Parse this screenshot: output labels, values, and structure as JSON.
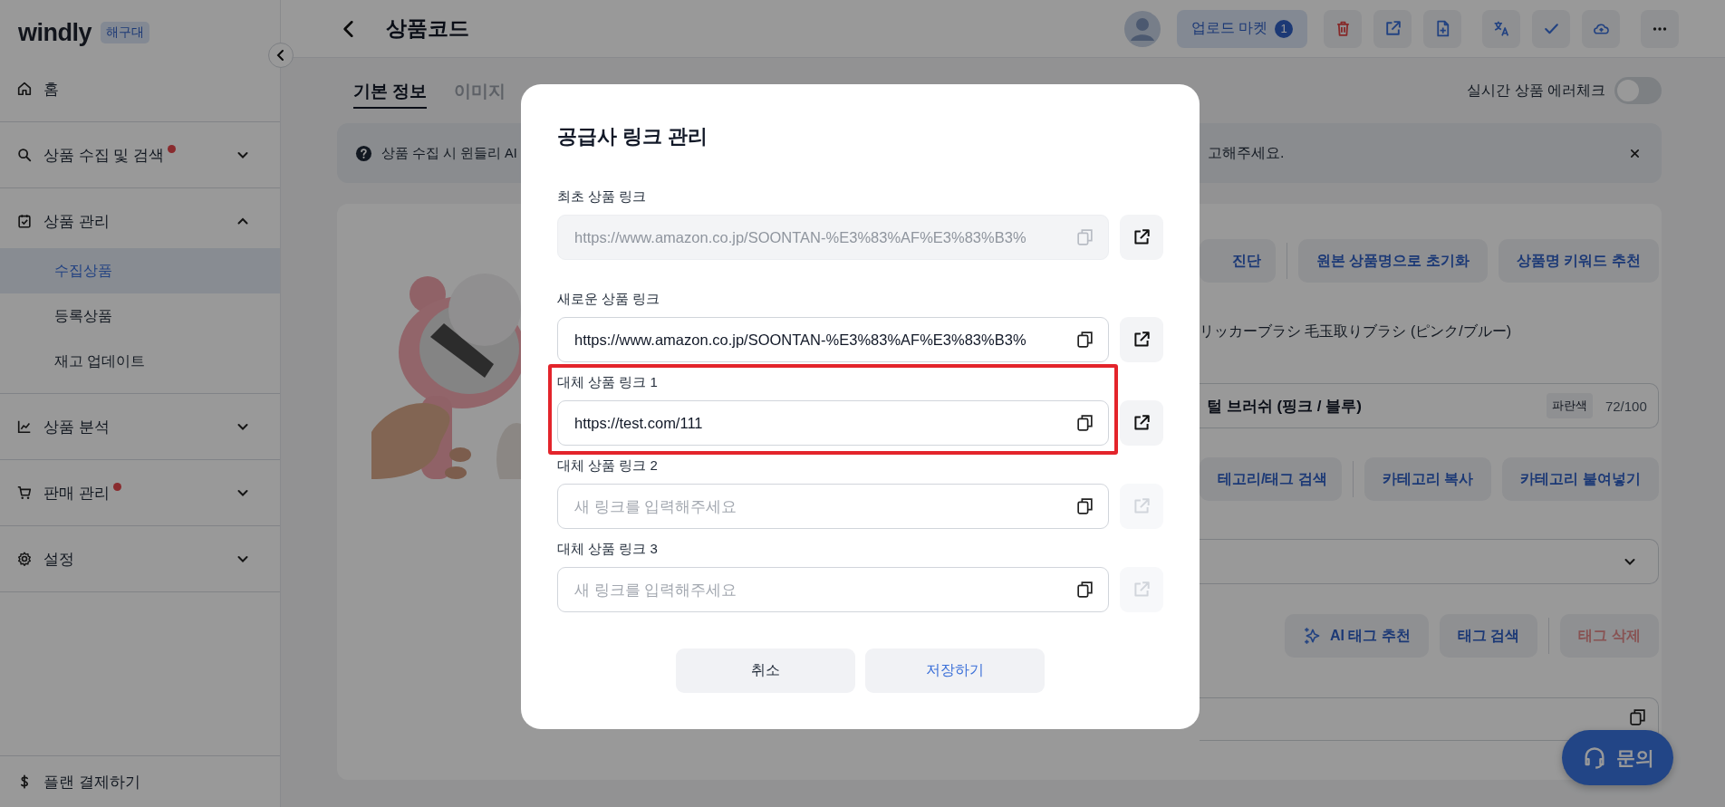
{
  "sidebar": {
    "logo": "windly",
    "badge": "해구대",
    "home": {
      "label": "홈"
    },
    "groups": [
      {
        "kind": "search",
        "label": "상품 수집 및 검색",
        "alert": true,
        "expanded": false
      },
      {
        "kind": "clipboard",
        "label": "상품 관리",
        "alert": false,
        "expanded": true,
        "children": [
          {
            "label": "수집상품",
            "selected": true
          },
          {
            "label": "등록상품",
            "selected": false
          },
          {
            "label": "재고 업데이트",
            "selected": false
          }
        ]
      },
      {
        "kind": "chart",
        "label": "상품 분석",
        "alert": false,
        "expanded": false
      },
      {
        "kind": "cart",
        "label": "판매 관리",
        "alert": true,
        "expanded": false
      },
      {
        "kind": "gear",
        "label": "설정",
        "alert": false,
        "expanded": false
      }
    ],
    "footer": {
      "label": "플랜 결제하기"
    }
  },
  "header": {
    "title": "상품코드",
    "upload_button": {
      "label": "업로드 마켓",
      "count": "1"
    }
  },
  "tabs": [
    {
      "label": "기본 정보",
      "selected": true
    },
    {
      "label": "이미지",
      "selected": false
    }
  ],
  "error_check": {
    "label": "실시간 상품 에러체크",
    "on": false
  },
  "banner": {
    "text_start": "상품 수집 시 윈들리 AI",
    "text_end": "고해주세요."
  },
  "editor": {
    "title_tools": [
      "진단",
      "원본 상품명으로 초기화",
      "상품명 키워드 추천"
    ],
    "source_title": "リッカーブラシ 毛玉取りブラシ (ピンク/ブルー)",
    "title_field": {
      "value": "털 브러쉬 (핑크 / 블루)",
      "tag": "파란색",
      "count": "72/100"
    },
    "category_tools": [
      "테고리/태그 검색",
      "카테고리 복사",
      "카테고리 붙여넣기"
    ],
    "tag_tools": [
      {
        "kind": "ai",
        "label": "AI 태그 추천",
        "disabled": false
      },
      {
        "kind": "plain",
        "label": "태그 검색",
        "disabled": false
      },
      {
        "kind": "danger",
        "label": "태그 삭제",
        "disabled": true
      }
    ]
  },
  "inquiry_button": {
    "label": "문의"
  },
  "modal": {
    "title": "공급사 링크 관리",
    "fields": [
      {
        "label": "최초 상품 링크",
        "value": "https://www.amazon.co.jp/SOONTAN-%E3%83%AF%E3%83%B3%",
        "disabled": true,
        "highlighted": false,
        "open_disabled": false
      },
      {
        "label": "새로운 상품 링크",
        "value": "https://www.amazon.co.jp/SOONTAN-%E3%83%AF%E3%83%B3%",
        "disabled": false,
        "highlighted": false,
        "open_disabled": false
      },
      {
        "label": "대체 상품 링크 1",
        "value": "https://test.com/111",
        "disabled": false,
        "highlighted": true,
        "open_disabled": false
      },
      {
        "label": "대체 상품 링크 2",
        "placeholder": "새 링크를 입력해주세요",
        "disabled": false,
        "highlighted": false,
        "open_disabled": true
      },
      {
        "label": "대체 상품 링크 3",
        "placeholder": "새 링크를 입력해주세요",
        "disabled": false,
        "highlighted": false,
        "open_disabled": true
      }
    ],
    "buttons": [
      {
        "kind": "secondary",
        "label": "취소"
      },
      {
        "kind": "primary",
        "label": "저장하기"
      }
    ]
  }
}
